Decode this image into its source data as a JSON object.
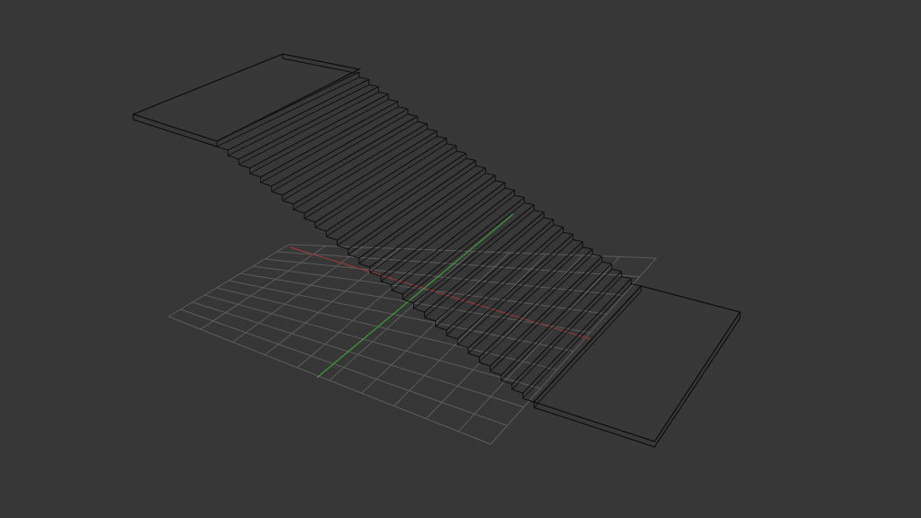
{
  "viewport": {
    "background_color": "#373737",
    "grid_color": "#5a5a5a",
    "wire_color": "#101010",
    "x_axis_color": "#8c3a3a",
    "y_axis_color": "#3a9a3a"
  },
  "scene": {
    "object": "staircase",
    "step_count": 30,
    "landings": 2,
    "grid_cells": 10
  }
}
